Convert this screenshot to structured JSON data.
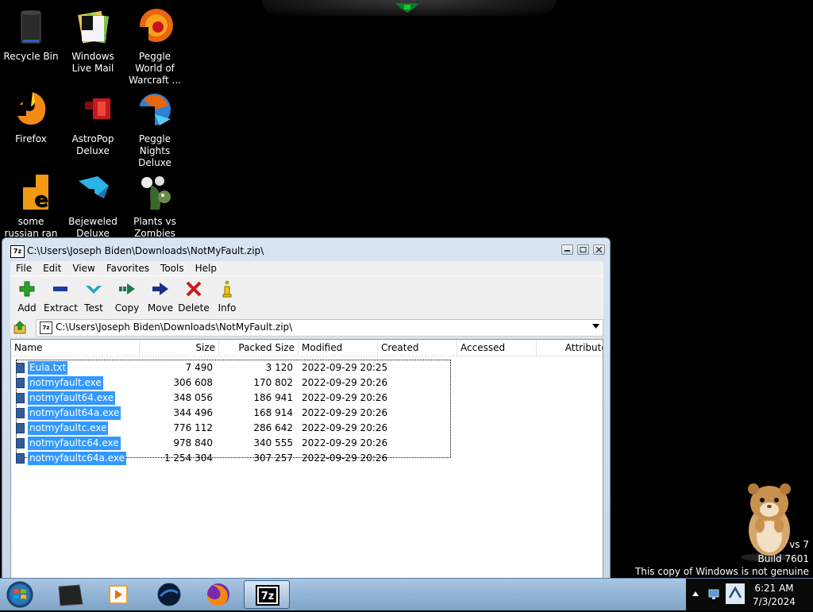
{
  "desktop": {
    "icons": [
      {
        "label": "Recycle Bin",
        "icon": "recycle-bin-icon"
      },
      {
        "label": "Windows Live Mail",
        "icon": "mail-icon"
      },
      {
        "label": "Peggle World of Warcraft ...",
        "icon": "peggle-icon"
      },
      {
        "label": "Firefox",
        "icon": "firefox-icon"
      },
      {
        "label": "AstroPop Deluxe",
        "icon": "astropop-icon"
      },
      {
        "label": "Peggle Nights Deluxe",
        "icon": "peggle-nights-icon"
      },
      {
        "label": "some russian ran a rat",
        "icon": "file-icon"
      },
      {
        "label": "Bejeweled Deluxe",
        "icon": "bejeweled-icon"
      },
      {
        "label": "Plants vs Zombies",
        "icon": "pvz-icon"
      }
    ],
    "watermark": {
      "line1": "vs 7",
      "line2": "Build 7601",
      "line3": "This copy of Windows is not genuine"
    }
  },
  "window": {
    "title": "C:\\Users\\Joseph Biden\\Downloads\\NotMyFault.zip\\",
    "title_icon": "7z",
    "menu": [
      "File",
      "Edit",
      "View",
      "Favorites",
      "Tools",
      "Help"
    ],
    "toolbar": [
      {
        "label": "Add",
        "icon": "add-icon",
        "color": "#2aa12a"
      },
      {
        "label": "Extract",
        "icon": "extract-icon",
        "color": "#1a3d9e"
      },
      {
        "label": "Test",
        "icon": "test-icon",
        "color": "#1ea6c4"
      },
      {
        "label": "Copy",
        "icon": "copy-icon",
        "color": "#1f7a4d"
      },
      {
        "label": "Move",
        "icon": "move-icon",
        "color": "#1a2f8a"
      },
      {
        "label": "Delete",
        "icon": "delete-icon",
        "color": "#d01818"
      },
      {
        "label": "Info",
        "icon": "info-icon",
        "color": "#c8a000"
      }
    ],
    "address": "C:\\Users\\Joseph Biden\\Downloads\\NotMyFault.zip\\",
    "columns": [
      "Name",
      "Size",
      "Packed Size",
      "Modified",
      "Created",
      "Accessed",
      "Attributes"
    ],
    "files": [
      {
        "name": "Eula.txt",
        "size": "7 490",
        "packed": "3 120",
        "modified": "2022-09-29 20:25"
      },
      {
        "name": "notmyfault.exe",
        "size": "306 608",
        "packed": "170 802",
        "modified": "2022-09-29 20:26"
      },
      {
        "name": "notmyfault64.exe",
        "size": "348 056",
        "packed": "186 941",
        "modified": "2022-09-29 20:26"
      },
      {
        "name": "notmyfault64a.exe",
        "size": "344 496",
        "packed": "168 914",
        "modified": "2022-09-29 20:26"
      },
      {
        "name": "notmyfaultc.exe",
        "size": "776 112",
        "packed": "286 642",
        "modified": "2022-09-29 20:26"
      },
      {
        "name": "notmyfaultc64.exe",
        "size": "978 840",
        "packed": "340 555",
        "modified": "2022-09-29 20:26"
      },
      {
        "name": "notmyfaultc64a.exe",
        "size": "1 254 304",
        "packed": "307 257",
        "modified": "2022-09-29 20:26"
      }
    ]
  },
  "taskbar": {
    "items": [
      "start-orb",
      "app-icon",
      "media-player-icon",
      "game-icon",
      "firefox-icon",
      "7zip-icon"
    ],
    "active": "7zip-icon",
    "clock": {
      "time": "6:21 AM",
      "date": "7/3/2024"
    }
  }
}
